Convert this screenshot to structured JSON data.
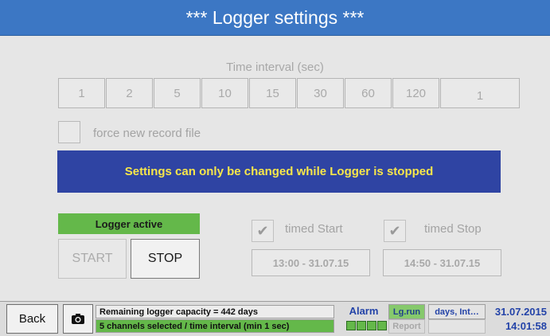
{
  "header": {
    "title": "***  Logger settings  ***"
  },
  "interval": {
    "label": "Time interval (sec)",
    "buttons": [
      "1",
      "2",
      "5",
      "10",
      "15",
      "30",
      "60",
      "120",
      "1"
    ]
  },
  "force_record": {
    "label": "force new record file",
    "checked": false
  },
  "banner": {
    "text": "Settings can only be changed while Logger is stopped"
  },
  "logger": {
    "status": "Logger active",
    "status_color": "#64b84a",
    "start_label": "START",
    "stop_label": "STOP"
  },
  "timed_start": {
    "label": "timed Start",
    "checked": true,
    "check_icon": "check-icon",
    "check_glyph": "✔",
    "time": "13:00 - 31.07.15"
  },
  "timed_stop": {
    "label": "timed Stop",
    "checked": true,
    "check_icon": "check-icon",
    "check_glyph": "✔",
    "time": "14:50 - 31.07.15"
  },
  "statusbar": {
    "back_label": "Back",
    "camera_icon": "camera-icon",
    "message1": "Remaining logger capacity = 442 days",
    "message2": "5 channels selected / time interval (min 1 sec)",
    "alarm_label": "Alarm",
    "lg_run": "Lg.run",
    "report": "Report",
    "days": "days, Int…",
    "date": "31.07.2015",
    "time": "14:01:58"
  },
  "colors": {
    "header": "#3c77c4",
    "banner_bg": "#2f44a3",
    "banner_text": "#f7e64a",
    "status_blue": "#2343a8",
    "green": "#64b84a"
  }
}
